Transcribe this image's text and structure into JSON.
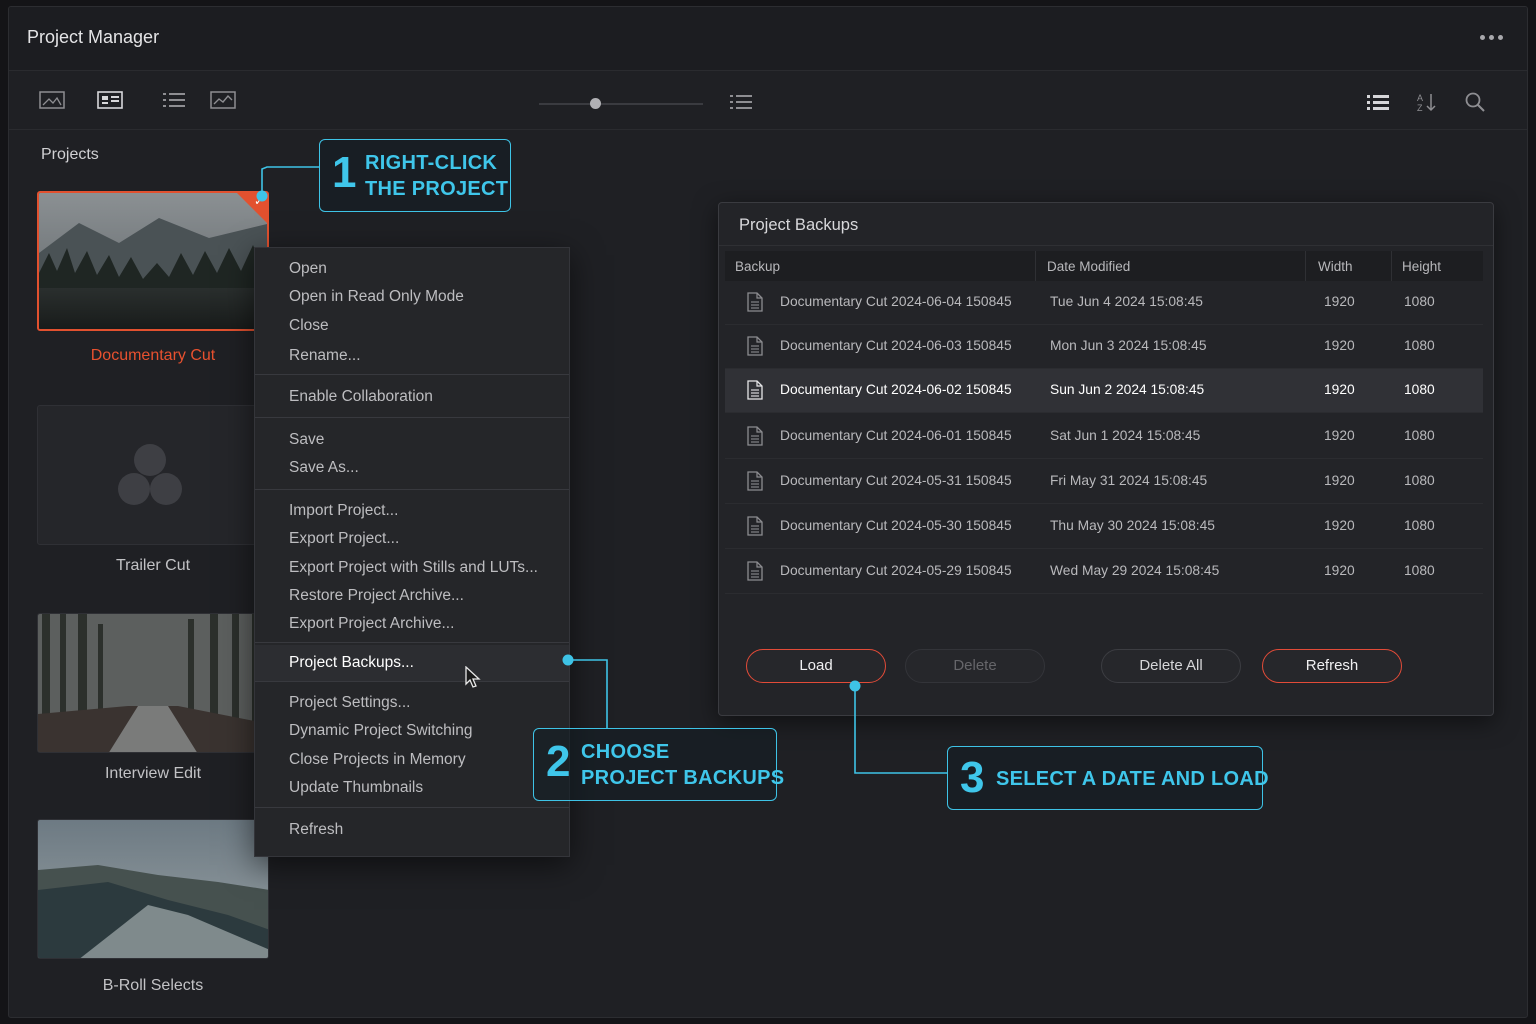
{
  "window": {
    "title": "Project Manager"
  },
  "sidebar": {
    "label": "Projects",
    "projects": [
      {
        "name": "Documentary Cut",
        "selected": true
      },
      {
        "name": "Trailer Cut",
        "selected": false
      },
      {
        "name": "Interview Edit",
        "selected": false
      },
      {
        "name": "B-Roll Selects",
        "selected": false
      }
    ]
  },
  "context_menu": {
    "items": [
      "Open",
      "Open in Read Only Mode",
      "Close",
      "Rename...",
      "Enable Collaboration",
      "Save",
      "Save As...",
      "Import Project...",
      "Export Project...",
      "Export Project with Stills and LUTs...",
      "Restore Project Archive...",
      "Export Project Archive...",
      "Project Backups...",
      "Project Settings...",
      "Dynamic Project Switching",
      "Close Projects in Memory",
      "Update Thumbnails",
      "Refresh"
    ],
    "active_item": "Project Backups..."
  },
  "backups_panel": {
    "title": "Project Backups",
    "columns": [
      "Backup",
      "Date Modified",
      "Width",
      "Height"
    ],
    "rows": [
      [
        "Documentary Cut 2024-06-04 150845",
        "Tue Jun 4 2024 15:08:45",
        "1920",
        "1080"
      ],
      [
        "Documentary Cut 2024-06-03 150845",
        "Mon Jun 3 2024 15:08:45",
        "1920",
        "1080"
      ],
      [
        "Documentary Cut 2024-06-02 150845",
        "Sun Jun 2 2024 15:08:45",
        "1920",
        "1080"
      ],
      [
        "Documentary Cut 2024-06-01 150845",
        "Sat Jun 1 2024 15:08:45",
        "1920",
        "1080"
      ],
      [
        "Documentary Cut 2024-05-31 150845",
        "Fri May 31 2024 15:08:45",
        "1920",
        "1080"
      ],
      [
        "Documentary Cut 2024-05-30 150845",
        "Thu May 30 2024 15:08:45",
        "1920",
        "1080"
      ],
      [
        "Documentary Cut 2024-05-29 150845",
        "Wed May 29 2024 15:08:45",
        "1920",
        "1080"
      ]
    ],
    "selected_row": 2,
    "buttons": {
      "load": "Load",
      "delete": "Delete",
      "delete_all": "Delete All",
      "refresh": "Refresh"
    }
  },
  "callouts": [
    {
      "number": "1",
      "line1": "RIGHT-CLICK",
      "line2": "THE PROJECT"
    },
    {
      "number": "2",
      "line1": "CHOOSE",
      "line2": "PROJECT BACKUPS"
    },
    {
      "number": "3",
      "line1": "SELECT A DATE AND LOAD",
      "line2": ""
    }
  ],
  "colors": {
    "accent_red": "#e2512f",
    "callout_cyan": "#3fc6ea",
    "background": "#1f2024"
  },
  "icons": {
    "toolbar_left": [
      "thumbnail-view-icon",
      "grid-view-icon",
      "list-view-icon",
      "chart-view-icon"
    ],
    "toolbar_mid": [
      "list-icon"
    ],
    "toolbar_right": [
      "list-mode-icon",
      "sort-icon",
      "search-icon"
    ],
    "title_right": "more-options-icon"
  }
}
